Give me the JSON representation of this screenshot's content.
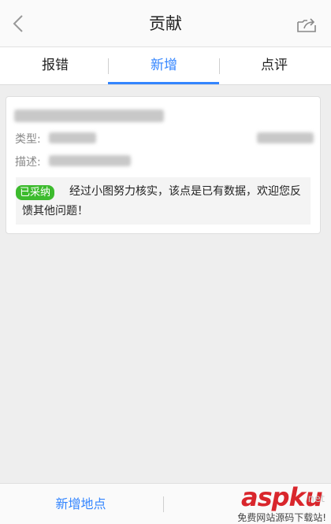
{
  "header": {
    "title": "贡献"
  },
  "tabs": [
    {
      "label": "报错"
    },
    {
      "label": "新增"
    },
    {
      "label": "点评"
    }
  ],
  "card": {
    "type_label": "类型:",
    "desc_label": "描述:",
    "badge": "已采纳",
    "notice": "经过小图努力核实，该点是已有数据，欢迎您反馈其他问题！"
  },
  "bottom": {
    "add_place": "新增地点"
  },
  "watermark": {
    "brand": "aspku",
    "suffix": ".net",
    "tagline": "免费网站源码下载站!"
  },
  "colors": {
    "accent": "#3385ff",
    "badge": "#3dbb2e",
    "watermark": "#d9262c"
  }
}
